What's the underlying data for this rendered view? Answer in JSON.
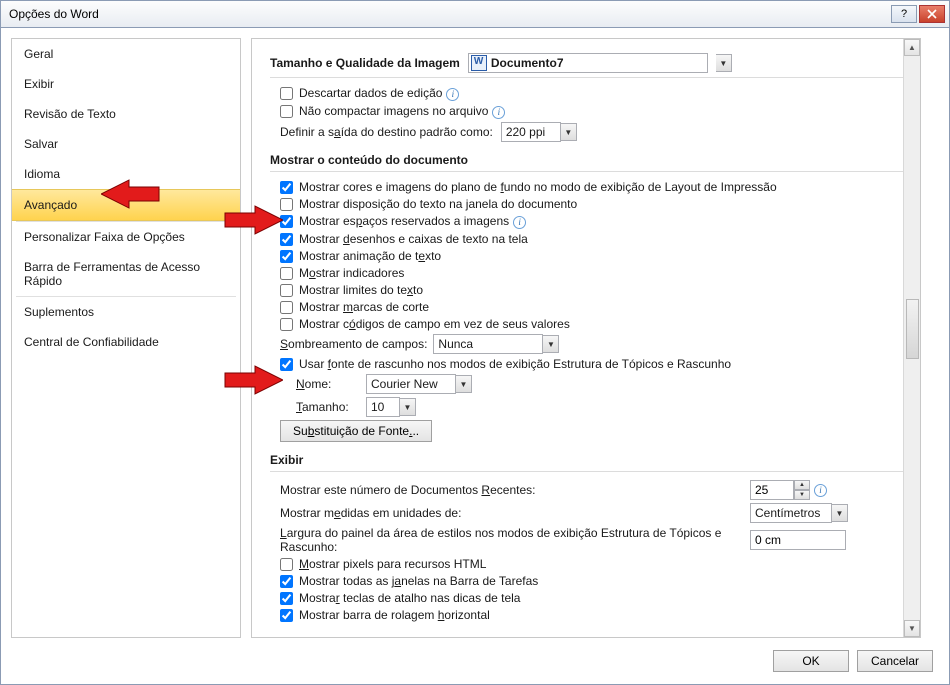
{
  "titlebar": {
    "title": "Opções do Word"
  },
  "sidebar": {
    "items": [
      {
        "label": "Geral"
      },
      {
        "label": "Exibir"
      },
      {
        "label": "Revisão de Texto"
      },
      {
        "label": "Salvar"
      },
      {
        "label": "Idioma"
      },
      {
        "label": "Avançado",
        "selected": true
      },
      {
        "label": "Personalizar Faixa de Opções"
      },
      {
        "label": "Barra de Ferramentas de Acesso Rápido"
      },
      {
        "label": "Suplementos"
      },
      {
        "label": "Central de Confiabilidade"
      }
    ]
  },
  "section_image": {
    "title": "Tamanho e Qualidade da Imagem",
    "doc_selector": "Documento7",
    "discard_edit": "Descartar dados de edição",
    "no_compress": "Não compactar imagens no arquivo",
    "dest_output_label": "Definir a saída do destino padrão como:",
    "dest_output_value": "220 ppi"
  },
  "section_content": {
    "title": "Mostrar o conteúdo do documento",
    "show_bg": "Mostrar cores e imagens do plano de fundo no modo de exibição de Layout de Impressão",
    "show_wrap": "Mostrar disposição do texto na janela do documento",
    "show_placeholders": "Mostrar espaços reservados a imagens",
    "show_drawings": "Mostrar desenhos e caixas de texto na tela",
    "show_textani": "Mostrar animação de texto",
    "show_indicators": "Mostrar indicadores",
    "show_textlimits": "Mostrar limites do texto",
    "show_cropmarks": "Mostrar marcas de corte",
    "show_fieldcodes": "Mostrar códigos de campo em vez de seus valores",
    "field_shading_label": "Sombreamento de campos:",
    "field_shading_value": "Nunca",
    "draft_font": "Usar fonte de rascunho nos modos de exibição Estrutura de Tópicos e Rascunho",
    "name_label": "Nome:",
    "name_value": "Courier New",
    "size_label": "Tamanho:",
    "size_value": "10",
    "font_sub_btn": "Substituição de Fonte..."
  },
  "section_display": {
    "title": "Exibir",
    "recent_docs_label": "Mostrar este número de Documentos Recentes:",
    "recent_docs_value": "25",
    "units_label": "Mostrar medidas em unidades de:",
    "units_value": "Centímetros",
    "style_pane_label": "Largura do painel da área de estilos nos modos de exibição Estrutura de Tópicos e Rascunho:",
    "style_pane_value": "0 cm",
    "show_pixels": "Mostrar pixels para recursos HTML",
    "show_taskbar": "Mostrar todas as janelas na Barra de Tarefas",
    "show_shortcuts": "Mostrar teclas de atalho nas dicas de tela",
    "show_hscroll": "Mostrar barra de rolagem horizontal"
  },
  "footer": {
    "ok": "OK",
    "cancel": "Cancelar"
  }
}
